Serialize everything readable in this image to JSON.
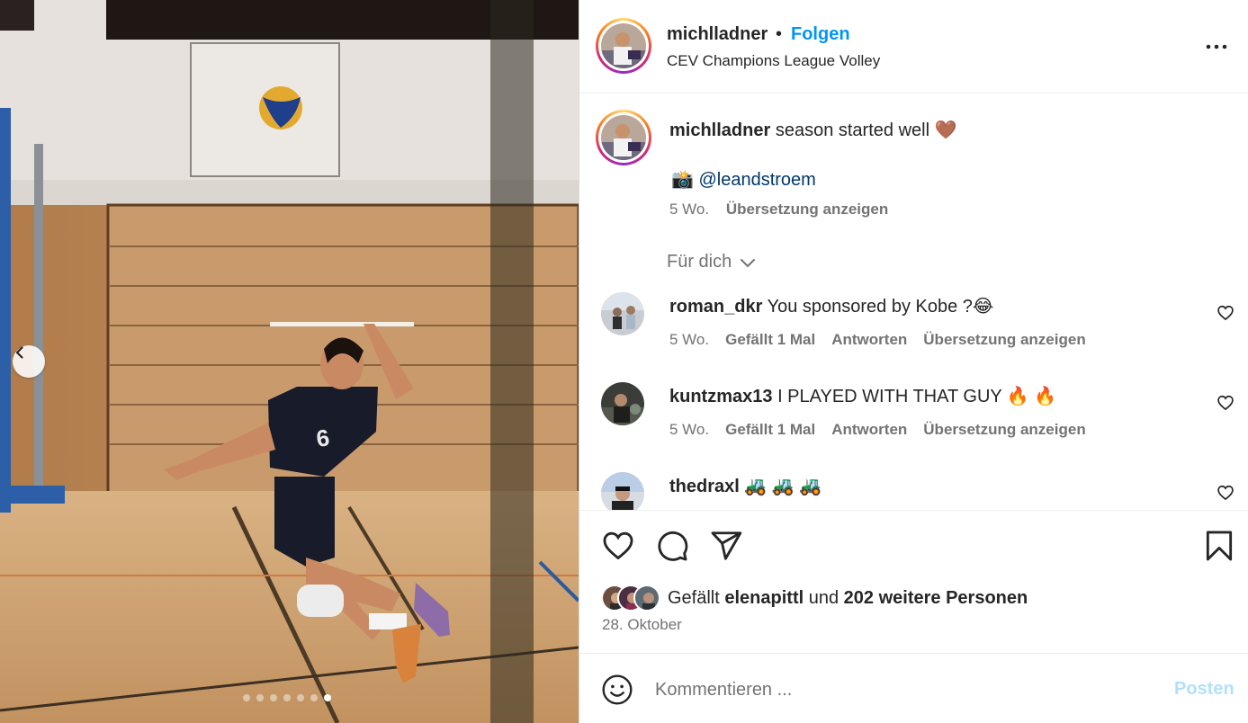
{
  "post": {
    "slide_count": 7,
    "active_slide": 7
  },
  "header": {
    "username": "michlladner",
    "separator": "•",
    "follow_label": "Folgen",
    "location": "CEV Champions League Volley"
  },
  "caption": {
    "username": "michlladner",
    "text": "season started well 🤎",
    "camera_emoji": "📸",
    "mention": "@leandstroem",
    "time": "5 Wo.",
    "translate_label": "Übersetzung anzeigen"
  },
  "filter": {
    "label": "Für dich"
  },
  "comments": [
    {
      "username": "roman_dkr",
      "text": "You sponsored by Kobe ?😂",
      "time": "5 Wo.",
      "likes": "Gefällt 1 Mal",
      "reply_label": "Antworten",
      "translate_label": "Übersetzung anzeigen"
    },
    {
      "username": "kuntzmax13",
      "text": "I PLAYED WITH THAT GUY 🔥 🔥",
      "time": "5 Wo.",
      "likes": "Gefällt 1 Mal",
      "reply_label": "Antworten",
      "translate_label": "Übersetzung anzeigen"
    },
    {
      "username": "thedraxl",
      "text": "🚜 🚜 🚜",
      "time": "",
      "likes": "",
      "reply_label": "",
      "translate_label": ""
    }
  ],
  "likes": {
    "prefix": "Gefällt",
    "user": "elenapittl",
    "middle": "und",
    "others": "202 weitere Personen"
  },
  "date": "28. Oktober",
  "composer": {
    "placeholder": "Kommentieren ...",
    "post_label": "Posten"
  },
  "icons": {
    "prev": "chevron-left-icon",
    "more": "more-horizontal-icon",
    "like": "heart-icon",
    "comment": "comment-icon",
    "share": "send-icon",
    "save": "bookmark-icon",
    "emoji": "emoji-icon"
  },
  "colors": {
    "accent": "#0095f6",
    "link": "#00376b",
    "muted": "#737373",
    "post_disabled": "#b2dffc"
  }
}
